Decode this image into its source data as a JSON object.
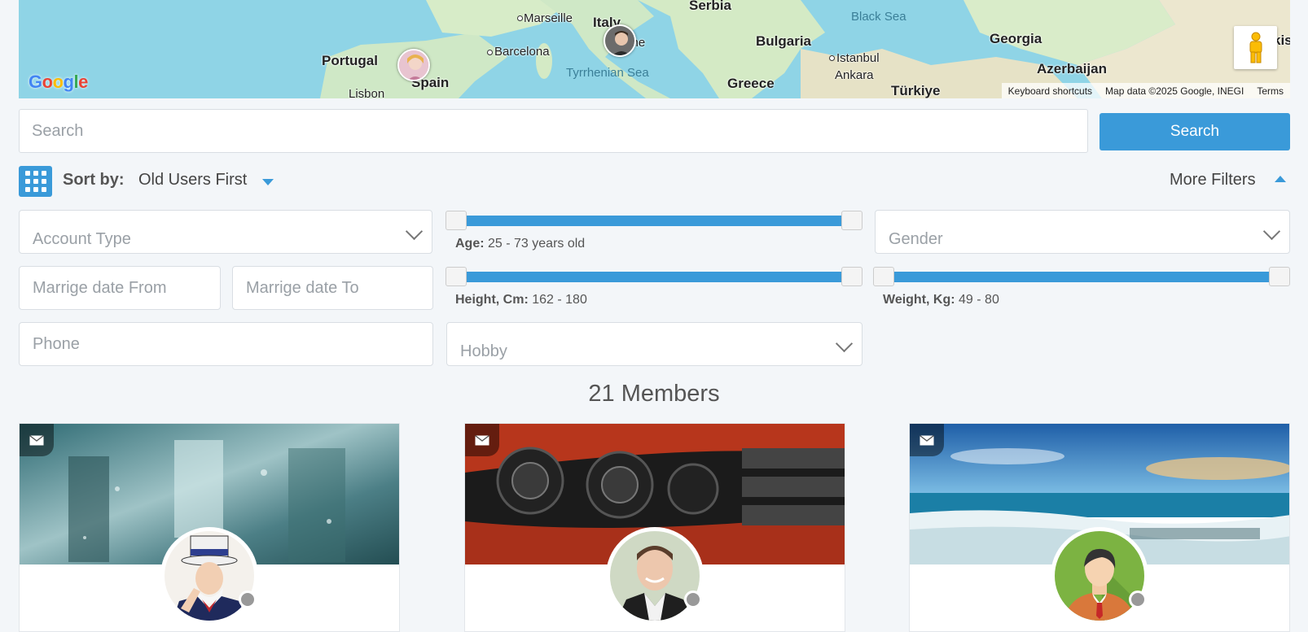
{
  "map": {
    "labels": {
      "serbia": "Serbia",
      "marseille": "Marseille",
      "italy": "Italy",
      "rome": "ome",
      "black_sea": "Black Sea",
      "georgia": "Georgia",
      "portugal": "Portugal",
      "barcelona": "Barcelona",
      "bulgaria": "Bulgaria",
      "istanbul": "Istanbul",
      "azerbaijan": "Azerbaijan",
      "ankara": "Ankara",
      "spain": "Spain",
      "tyrrhenian": "Tyrrhenian Sea",
      "greece": "Greece",
      "turkiye": "Türkiye",
      "lisbon": "Lisbon",
      "kis": "kis"
    },
    "google_logo": [
      "G",
      "o",
      "o",
      "g",
      "l",
      "e"
    ],
    "footer": {
      "shortcuts": "Keyboard shortcuts",
      "map_data": "Map data ©2025 Google, INEGI",
      "terms": "Terms"
    }
  },
  "search": {
    "placeholder": "Search",
    "button_label": "Search"
  },
  "sort": {
    "label": "Sort by:",
    "value": "Old Users First",
    "more_filters": "More Filters"
  },
  "filters": {
    "account_type": "Account Type",
    "gender": "Gender",
    "marriage_from": "Marrige date From",
    "marriage_to": "Marrige date To",
    "phone": "Phone",
    "hobby": "Hobby",
    "age": {
      "label": "Age:",
      "range": "25 - 73 years old",
      "min": 25,
      "max": 73
    },
    "height": {
      "label": "Height, Cm:",
      "range": "162 - 180",
      "min": 162,
      "max": 180
    },
    "weight": {
      "label": "Weight, Kg:",
      "range": "49 - 80",
      "min": 49,
      "max": 80
    }
  },
  "members": {
    "count_label": "21 Members",
    "cards": [
      {
        "cover": "rainy-street",
        "avatar": "uncle-sam",
        "status_color": "#999999"
      },
      {
        "cover": "car-headlight",
        "avatar": "young-man",
        "status_color": "#999999"
      },
      {
        "cover": "beach",
        "avatar": "default-male",
        "status_color": "#999999"
      }
    ]
  },
  "colors": {
    "accent": "#3a9ad9",
    "page_bg": "#f3f6f9"
  }
}
